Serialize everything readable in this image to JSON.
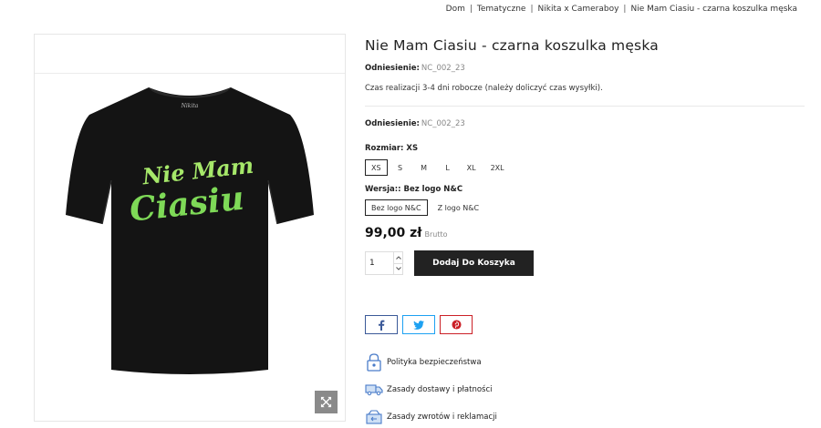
{
  "breadcrumb": {
    "items": [
      "Dom",
      "Tematyczne",
      "Nikita x Cameraboy",
      "Nie Mam Ciasiu - czarna koszulka męska"
    ],
    "separator": "|"
  },
  "product": {
    "title": "Nie Mam Ciasiu - czarna koszulka męska",
    "reference_label": "Odniesienie:",
    "reference_value": "NC_002_23",
    "lead_time": "Czas realizacji 3-4 dni robocze (należy doliczyć czas wysyłki).",
    "shirt_print_line1": "Nie Mam",
    "shirt_print_line2": "Ciasiu",
    "shirt_color": "#141414",
    "print_color": "#7ed957"
  },
  "size": {
    "label": "Rozmiar:",
    "selected": "XS",
    "options": [
      "XS",
      "S",
      "M",
      "L",
      "XL",
      "2XL"
    ]
  },
  "version": {
    "label": "Wersja::",
    "selected": "Bez logo N&C",
    "options": [
      "Bez logo N&C",
      "Z logo N&C"
    ]
  },
  "price": {
    "amount": "99,00 zł",
    "tax_label": "Brutto"
  },
  "cart": {
    "quantity": "1",
    "add_button": "Dodaj Do Koszyka"
  },
  "share": {
    "icons": [
      "facebook-icon",
      "twitter-icon",
      "pinterest-icon"
    ],
    "colors": {
      "facebook": "#3b5998",
      "twitter": "#1da1f2",
      "pinterest": "#cb2027"
    }
  },
  "reassurance": [
    {
      "icon": "lock-icon",
      "text": "Polityka bezpieczeństwa"
    },
    {
      "icon": "truck-icon",
      "text": "Zasady dostawy i płatności"
    },
    {
      "icon": "return-icon",
      "text": "Zasady zwrotów i reklamacji"
    }
  ],
  "colors": {
    "accent": "#222222",
    "icon_blue": "#4a7cc9"
  }
}
